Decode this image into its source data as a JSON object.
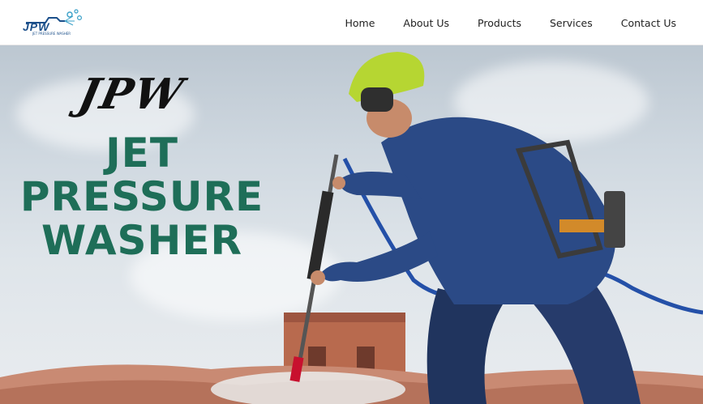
{
  "logo": {
    "text": "JPW",
    "tagline": "JET PRESSURE WASHER",
    "icon": "spray-nozzle-icon"
  },
  "nav": {
    "items": [
      {
        "label": "Home"
      },
      {
        "label": "About Us"
      },
      {
        "label": "Products"
      },
      {
        "label": "Services"
      },
      {
        "label": "Contact Us"
      }
    ]
  },
  "hero": {
    "brand": "JPW",
    "headline_line1": "JET",
    "headline_line2": "PRESSURE",
    "headline_line3": "WASHER",
    "image": "worker-pressure-washing-roof"
  },
  "colors": {
    "headline": "#1e6e58",
    "logo": "#1b4f8a",
    "helmet": "#b6d632",
    "suit": "#2b4a86"
  }
}
